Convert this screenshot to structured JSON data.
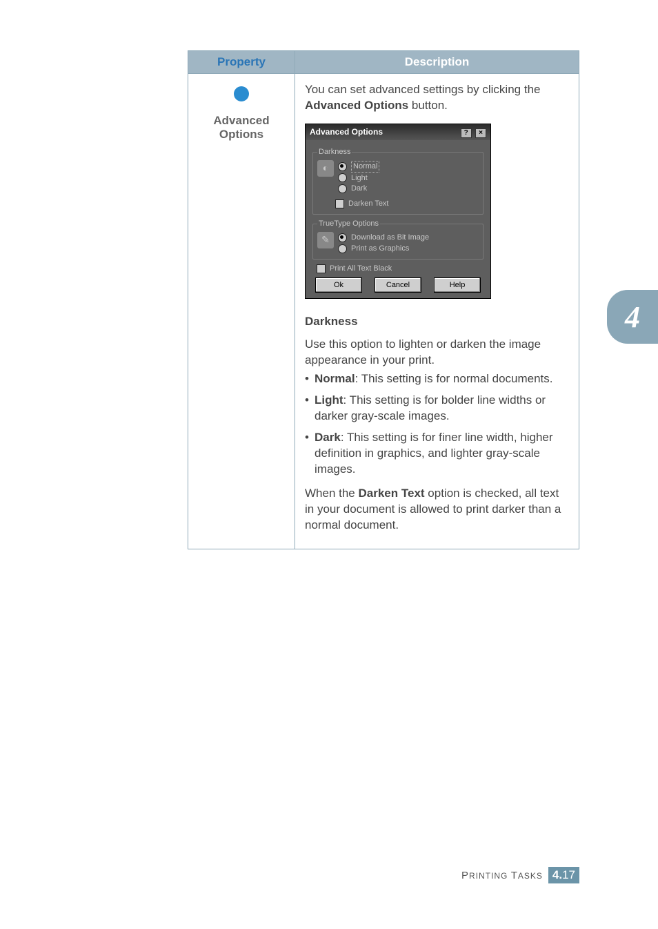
{
  "table": {
    "headers": {
      "property": "Property",
      "description": "Description"
    },
    "row": {
      "property_label": "Advanced Options",
      "intro_pre": "You can set advanced settings by clicking the ",
      "intro_bold": "Advanced Options",
      "intro_post": " button.",
      "dialog": {
        "title": "Advanced Options",
        "group_darkness": "Darkness",
        "darkness_options": {
          "normal": "Normal",
          "light": "Light",
          "dark": "Dark"
        },
        "darken_text": "Darken Text",
        "group_truetype": "TrueType Options",
        "truetype_options": {
          "bitimage": "Download as Bit Image",
          "graphics": "Print as Graphics"
        },
        "print_all_black": "Print All Text Black",
        "buttons": {
          "ok": "Ok",
          "cancel": "Cancel",
          "help": "Help"
        }
      },
      "darkness_heading": "Darkness",
      "darkness_intro": "Use this option to lighten or darken the image appearance in your print.",
      "options": {
        "normal": {
          "name": "Normal",
          "desc": ": This setting is for normal documents."
        },
        "light": {
          "name": "Light",
          "desc": ": This setting is for bolder line widths or darker gray-scale images."
        },
        "dark": {
          "name": "Dark",
          "desc": ": This setting is for finer line width, higher definition in graphics, and lighter gray-scale images."
        }
      },
      "darken_text_note_pre": "When the ",
      "darken_text_note_bold": "Darken Text",
      "darken_text_note_post": " option is checked, all text in your document is allowed to print darker than a normal document."
    }
  },
  "side_tab": "4",
  "footer": {
    "title_small": "P",
    "title_rest": "RINTING ",
    "title_small2": "T",
    "title_rest2": "ASKS",
    "chapter": "4.",
    "page": "17"
  }
}
